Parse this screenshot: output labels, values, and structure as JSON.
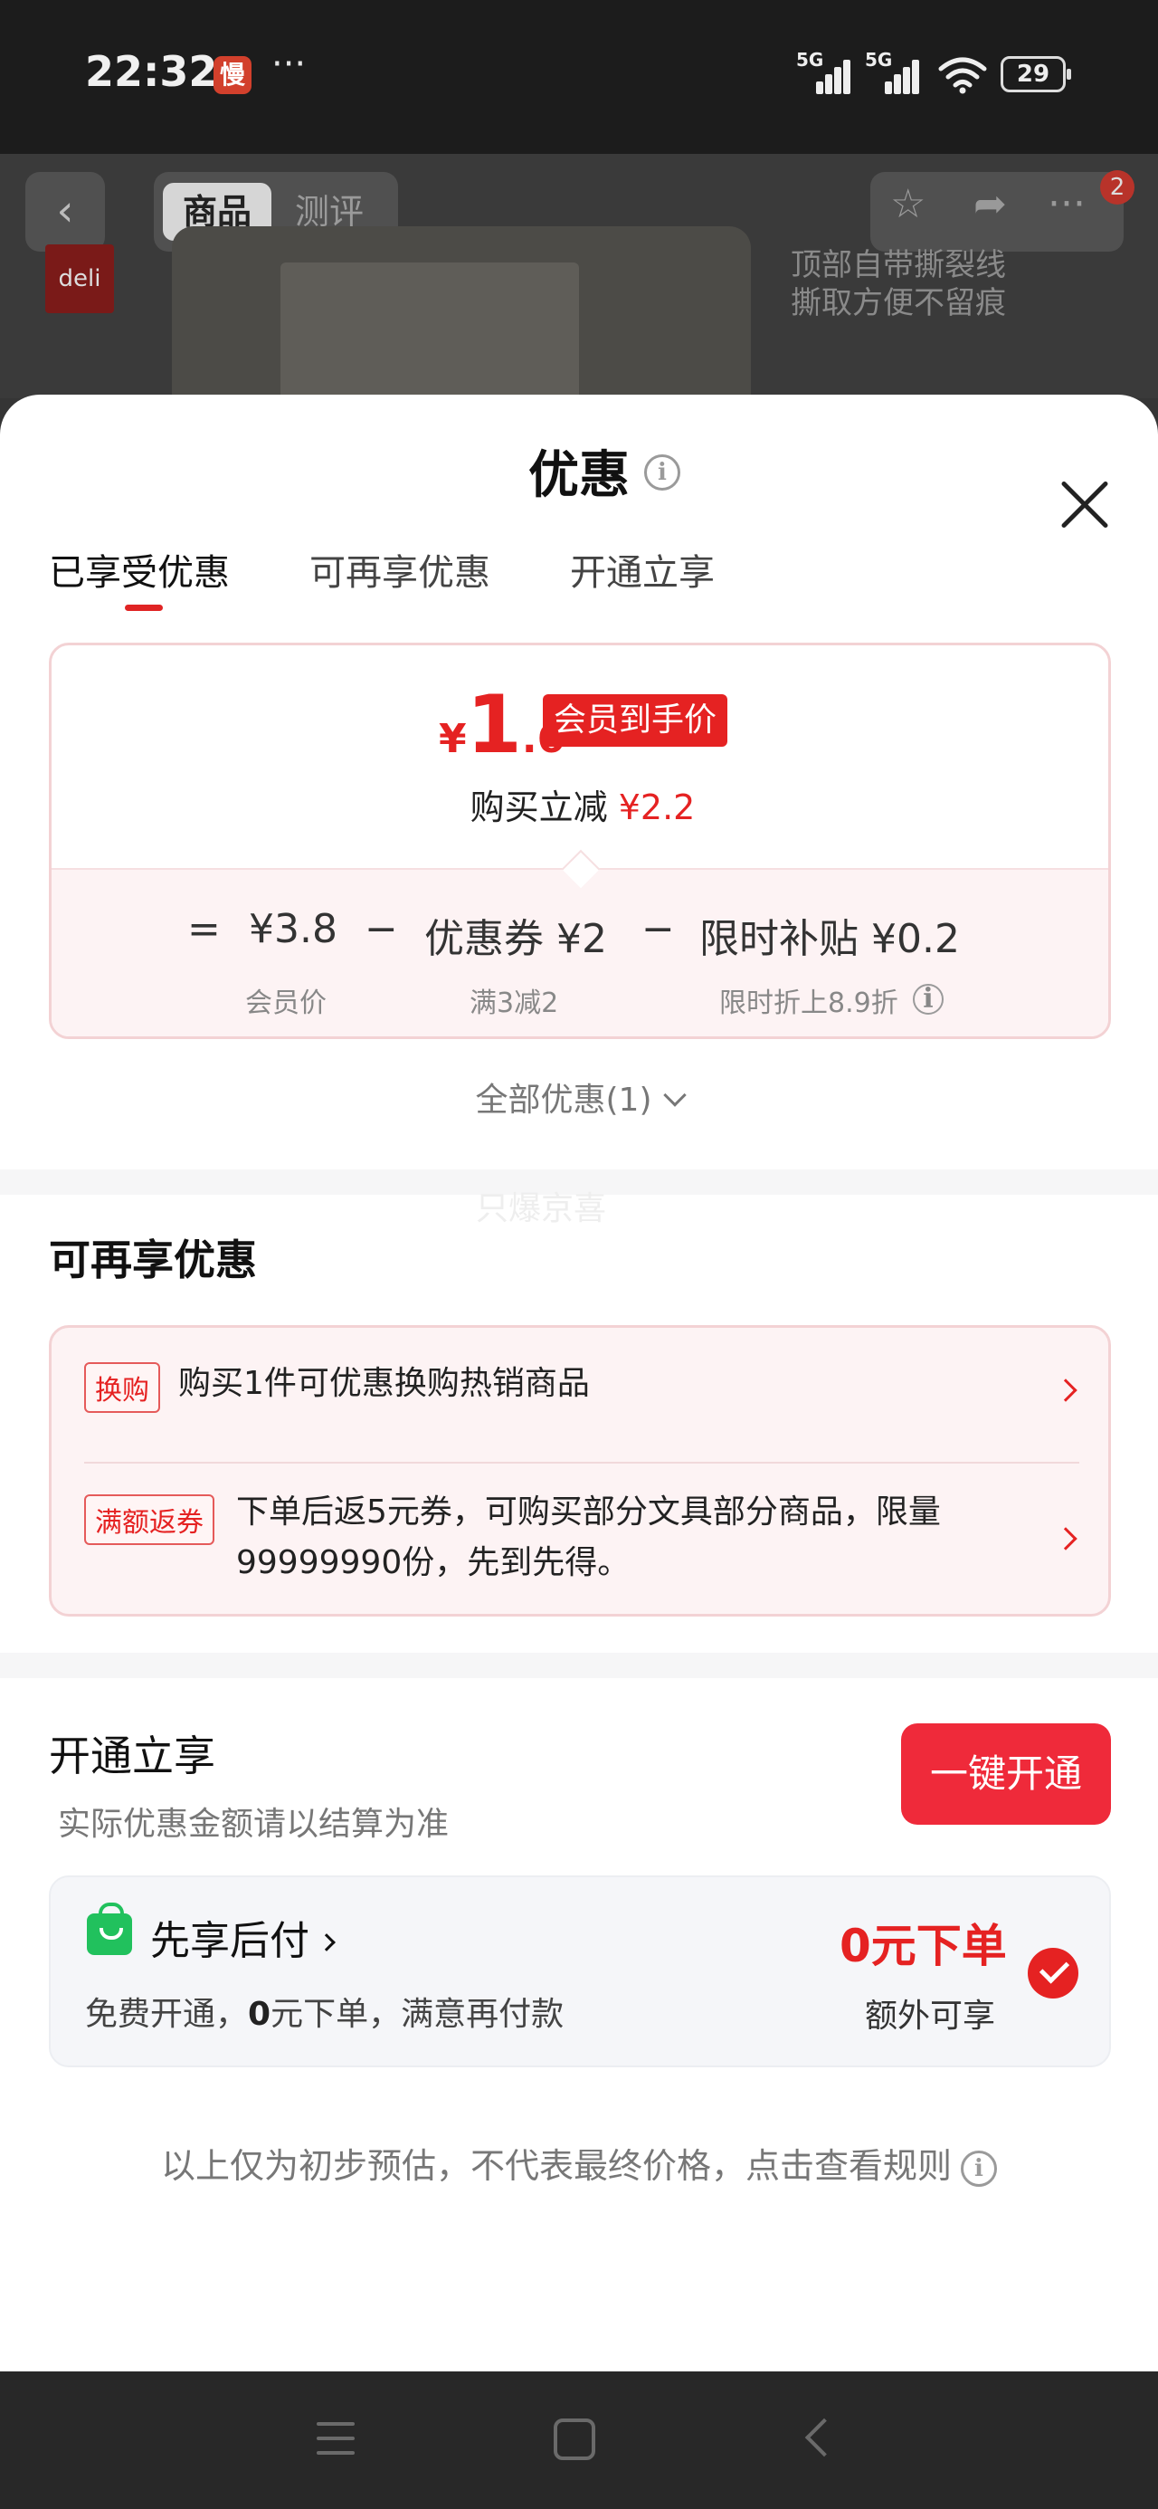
{
  "status_bar": {
    "time": "22:32",
    "app_badge": "慢",
    "more": "···",
    "signal1_label": "5G",
    "signal2_label": "5G",
    "battery": "29"
  },
  "top_nav": {
    "tab_product": "商品",
    "tab_review": "测评",
    "cart_badge": "2",
    "brand_logo": "deli",
    "product_caption_line1": "顶部自带撕裂线",
    "product_caption_line2": "撕取方便不留痕"
  },
  "sheet": {
    "title": "优惠",
    "tabs": [
      "已享受优惠",
      "可再享优惠",
      "开通立享"
    ],
    "price_card": {
      "currency": "¥",
      "price_int": "1",
      "price_dec": ".6",
      "member_badge": "会员到手价",
      "saving_label": "购买立减",
      "saving_amount": "¥2.2",
      "formula": {
        "equals": "=",
        "member_price": "¥3.8",
        "minus1": "−",
        "coupon": "优惠券 ¥2",
        "minus2": "−",
        "subsidy": "限时补贴 ¥0.2"
      },
      "formula_sub": {
        "member_price_label": "会员价",
        "coupon_label": "满3减2",
        "subsidy_label": "限时折上8.9折"
      }
    },
    "all_discounts": "全部优惠(1)",
    "ghost_text": "只爆京喜",
    "more_offers": {
      "title": "可再享优惠",
      "items": [
        {
          "tag": "换购",
          "text": "购买1件可优惠换购热销商品"
        },
        {
          "tag": "满额返券",
          "text_line1": "下单后返5元券，可购买部分文具部分商品，限量",
          "text_line2": "99999990份，先到先得。"
        }
      ]
    },
    "open_now": {
      "title": "开通立享",
      "subtitle": "实际优惠金额请以结算为准",
      "button": "一键开通",
      "paylater": {
        "title": "先享后付",
        "desc_prefix": "免费开通，",
        "desc_zero": "0",
        "desc_suffix": "元下单，满意再付款",
        "zero_order": "0元下单",
        "extra": "额外可享"
      }
    },
    "disclaimer": "以上仅为初步预估，不代表最终价格，点击查看规则"
  },
  "colors": {
    "accent_red": "#e52222",
    "button_red": "#ef2a3a",
    "green": "#21c15d"
  }
}
